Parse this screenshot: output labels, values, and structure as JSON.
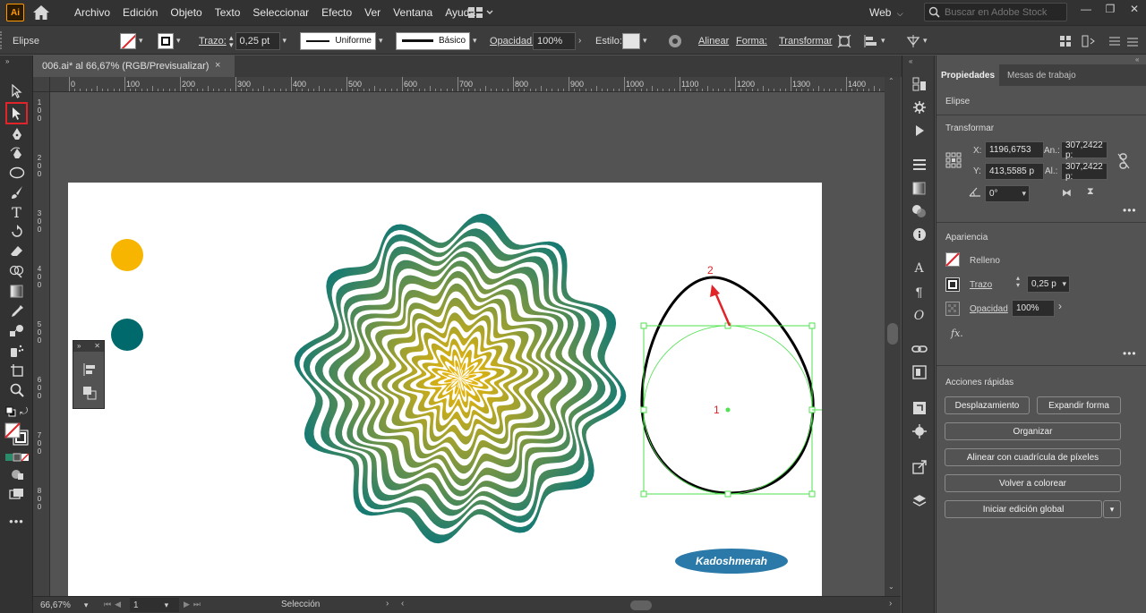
{
  "app": {
    "logo": "Ai",
    "menu": [
      "Archivo",
      "Edición",
      "Objeto",
      "Texto",
      "Seleccionar",
      "Efecto",
      "Ver",
      "Ventana",
      "Ayuda"
    ],
    "workspace": "Web",
    "search_placeholder": "Buscar en Adobe Stock"
  },
  "control_bar": {
    "object_type": "Elipse",
    "stroke_label": "Trazo:",
    "stroke_weight": "0,25 pt",
    "profile": "Uniforme",
    "brush": "Básico",
    "opacity_label": "Opacidad:",
    "opacity_value": "100%",
    "style_label": "Estilo:",
    "align_label": "Alinear",
    "shape_label": "Forma:",
    "transform_label": "Transformar"
  },
  "document": {
    "tab_title": "006.ai* al 66,67% (RGB/Previsualizar)",
    "close": "×"
  },
  "rulers": {
    "top": [
      "0",
      "100",
      "200",
      "300",
      "400",
      "500",
      "600",
      "700",
      "800",
      "900",
      "1000",
      "1100",
      "1200",
      "1300",
      "1400"
    ],
    "left": [
      "100",
      "200",
      "300",
      "400",
      "500",
      "600",
      "700",
      "800"
    ]
  },
  "canvas": {
    "annotation_1": "1",
    "annotation_2": "2",
    "watermark": "Kadoshmerah",
    "colors": {
      "yellow": "#f7b500",
      "teal": "#00696b",
      "gradient_start": "#f2b807",
      "gradient_end": "#167a73",
      "selection": "#4fe34f",
      "annotation": "#e0242a",
      "watermark_bg": "#2a79a8"
    }
  },
  "status_bar": {
    "zoom": "66,67%",
    "artboard": "1",
    "tool": "Selección"
  },
  "properties": {
    "tabs": [
      "Propiedades",
      "Mesas de trabajo"
    ],
    "object": "Elipse",
    "transform": {
      "title": "Transformar",
      "x_label": "X:",
      "x": "1196,6753",
      "y_label": "Y:",
      "y": "413,5585 p",
      "w_label": "An.:",
      "w": "307,2422 p:",
      "h_label": "Al.:",
      "h": "307,2422 p:",
      "angle": "0°"
    },
    "appearance": {
      "title": "Apariencia",
      "fill": "Relleno",
      "stroke": "Trazo",
      "stroke_weight": "0,25 p",
      "opacity": "Opacidad",
      "opacity_value": "100%",
      "fx": "fx."
    },
    "quick_actions": {
      "title": "Acciones rápidas",
      "offset": "Desplazamiento",
      "expand": "Expandir forma",
      "arrange": "Organizar",
      "align_pixel": "Alinear con cuadrícula de píxeles",
      "recolor": "Volver a colorear",
      "global_edit": "Iniciar edición global"
    },
    "more": "•••"
  }
}
